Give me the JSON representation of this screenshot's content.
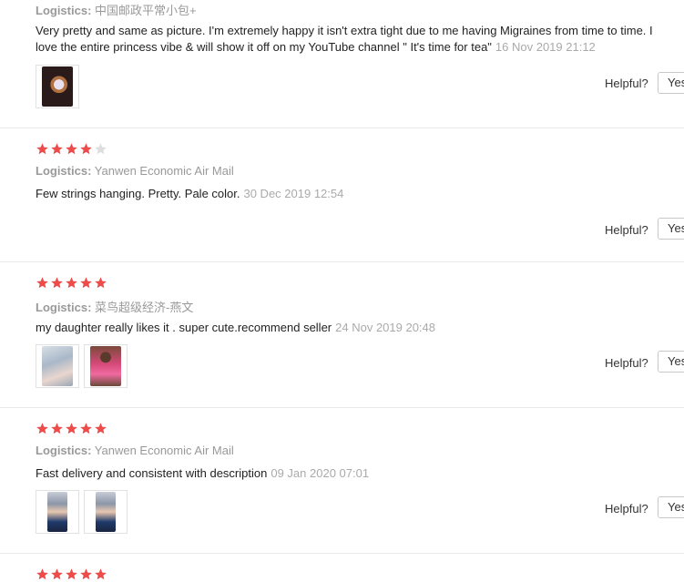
{
  "accent_star_color": "#ee4b4b",
  "empty_star_color": "#dddddd",
  "helpful_label": "Helpful?",
  "yes_label": "Yes",
  "logistics_label": "Logistics:",
  "reviews": [
    {
      "logistics": "中国邮政平常小包+",
      "text_line1": "Very pretty and same as picture. I'm extremely happy it isn't extra tight due to me having Migraines from time to time. I",
      "text_line2": "love the entire princess vibe & will show it off on my YouTube channel \" It's time for tea\"",
      "date": "16 Nov 2019 21:12",
      "photos": [
        "photo-1"
      ]
    },
    {
      "stars": 4,
      "logistics": "Yanwen Economic Air Mail",
      "text": "Few strings hanging. Pretty. Pale color.",
      "date": "30 Dec 2019 12:54",
      "photos": []
    },
    {
      "stars": 5,
      "logistics": "菜鸟超级经济-燕文",
      "text": "my daughter really likes it . super cute.recommend seller",
      "date": "24 Nov 2019 20:48",
      "photos": [
        "photo-1",
        "photo-2"
      ]
    },
    {
      "stars": 5,
      "logistics": "Yanwen Economic Air Mail",
      "text": "Fast delivery and consistent with description",
      "date": "09 Jan 2020 07:01",
      "photos": [
        "photo-1",
        "photo-2"
      ]
    },
    {
      "stars": 5
    }
  ]
}
